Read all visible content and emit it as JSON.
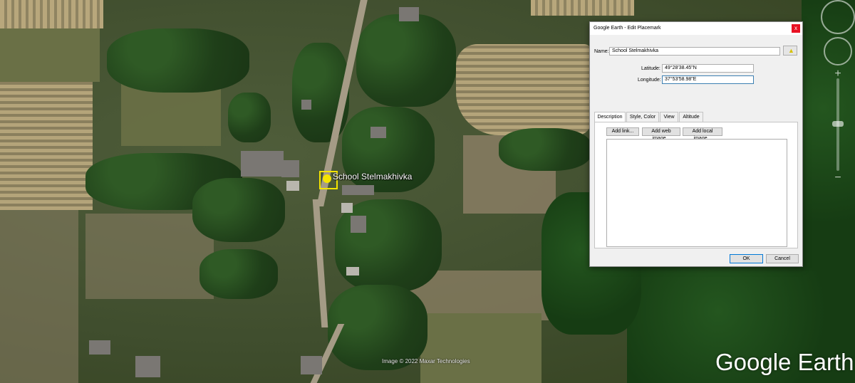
{
  "map": {
    "placemark_label": "School Stelmakhivka",
    "credit": "Image © 2022 Maxar Technologies",
    "logo": "Google Earth",
    "icons": [
      "look-ring-icon",
      "move-ring-icon",
      "zoom-in-icon",
      "zoom-out-icon",
      "placemark-pin-icon"
    ]
  },
  "dialog": {
    "title": "Google Earth - Edit Placemark",
    "close_label": "x",
    "name_label": "Name:",
    "name_value": "School Stelmakhivka",
    "latitude_label": "Latitude:",
    "latitude_value": "49°28'38.45\"N",
    "longitude_label": "Longitude:",
    "longitude_value": "37°53'58.98\"E",
    "tabs": [
      {
        "label": "Description",
        "active": true
      },
      {
        "label": "Style, Color",
        "active": false
      },
      {
        "label": "View",
        "active": false
      },
      {
        "label": "Altitude",
        "active": false
      }
    ],
    "buttons": {
      "add_link": "Add link...",
      "add_web_image": "Add web image...",
      "add_local_image": "Add local image...",
      "ok": "OK",
      "cancel": "Cancel"
    },
    "description_value": ""
  },
  "colors": {
    "placemark": "#f5e400",
    "close_button": "#e81123",
    "focus_border": "#3c7fb1"
  }
}
